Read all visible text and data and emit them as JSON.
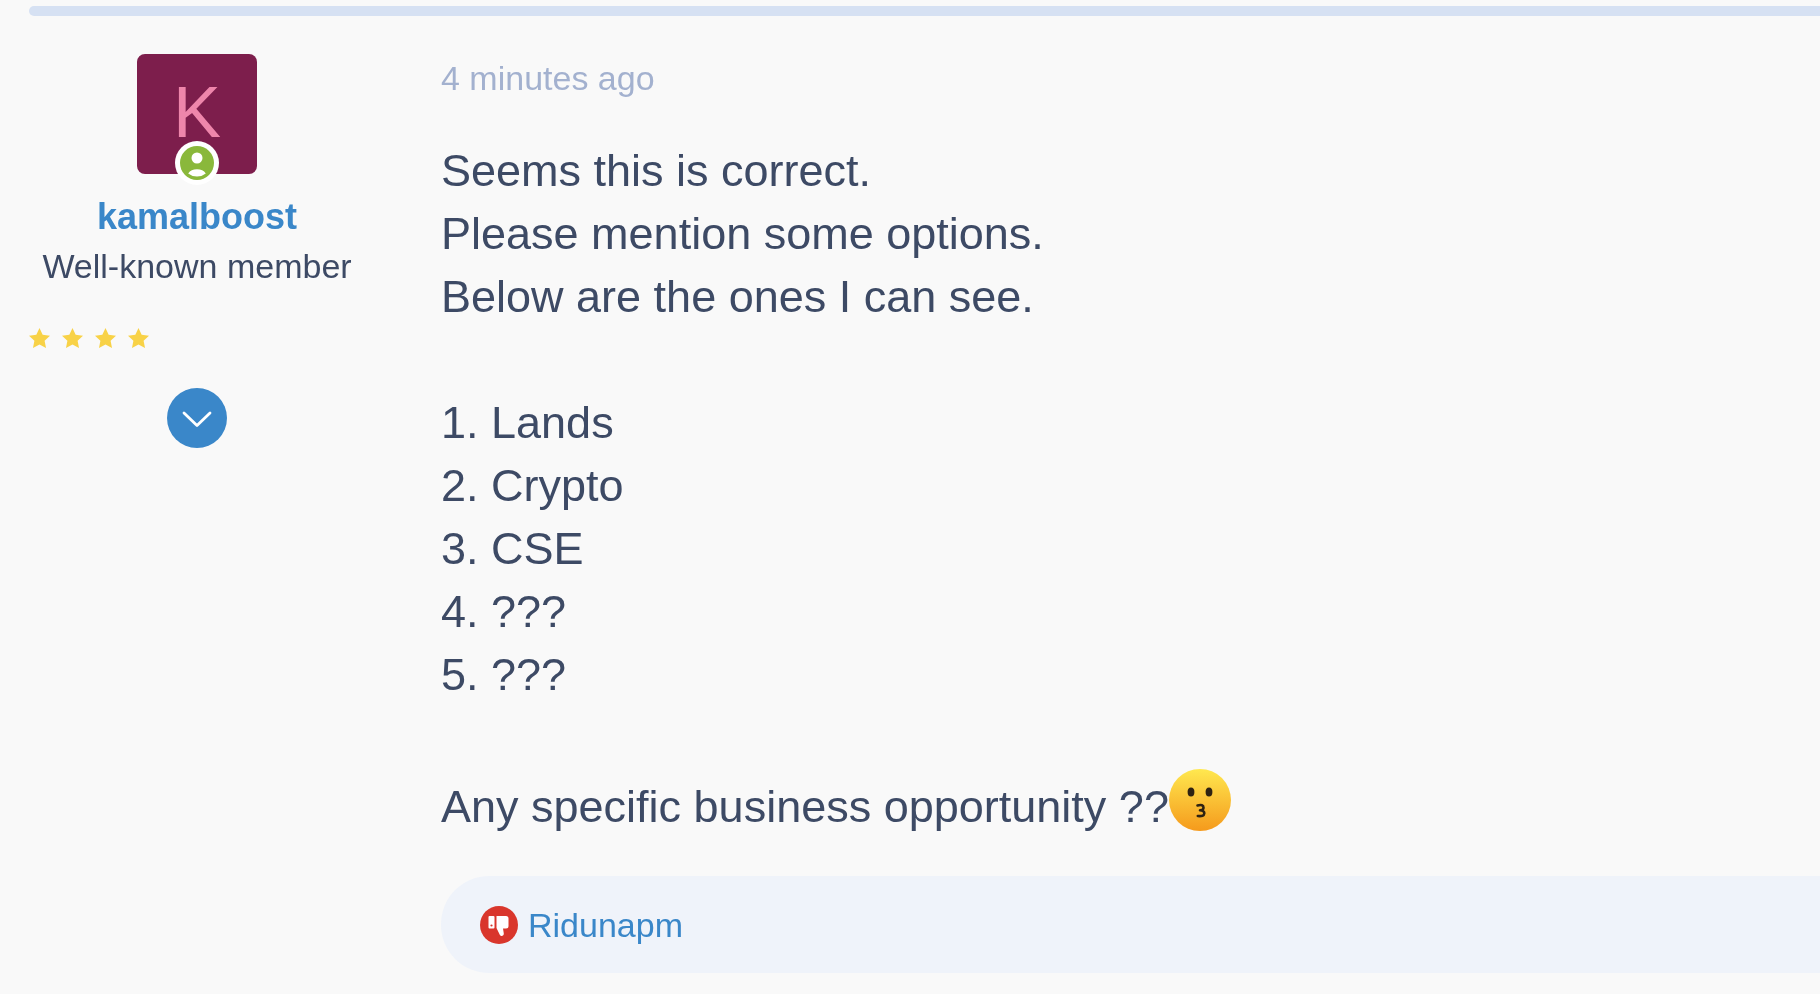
{
  "post": {
    "author": {
      "avatar_letter": "K",
      "online": true,
      "username": "kamalboost",
      "title": "Well-known member",
      "stars": 4
    },
    "timestamp": "4 minutes ago",
    "paragraphs": [
      {
        "lines": [
          "Seems this is correct.",
          "Please mention some options.",
          "Below are the ones I can see."
        ],
        "emoji": false
      },
      {
        "lines": [
          "1. Lands",
          "2. Crypto",
          "3. CSE",
          "4. ???",
          "5. ???"
        ],
        "emoji": false
      },
      {
        "lines": [
          "Any specific business opportunity ??"
        ],
        "emoji": true
      }
    ],
    "reactions": {
      "kind": "dislike",
      "users": "Ridunapm"
    }
  }
}
